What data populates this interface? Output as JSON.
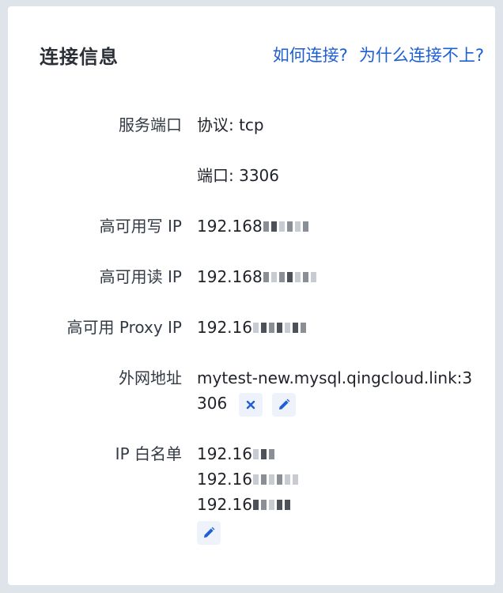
{
  "title": "连接信息",
  "links": {
    "how_to_connect": "如何连接?",
    "why_cant_connect": "为什么连接不上?"
  },
  "service_port": {
    "label": "服务端口",
    "protocol": "协议: tcp",
    "port": "端口: 3306"
  },
  "ha_write_ip": {
    "label": "高可用写 IP",
    "value": "192.168"
  },
  "ha_read_ip": {
    "label": "高可用读 IP",
    "value": "192.168"
  },
  "ha_proxy_ip": {
    "label": "高可用 Proxy IP",
    "value": "192.16"
  },
  "public_network": {
    "label": "外网地址",
    "value": "mytest-new.mysql.qingcloud.link:3306",
    "delete_icon": "close-icon",
    "edit_icon": "pencil-icon"
  },
  "ip_whitelist": {
    "label": "IP 白名单",
    "items": [
      "192.16",
      "192.16",
      "192.16"
    ],
    "edit_icon": "pencil-icon"
  },
  "colors": {
    "accent": "#1e5fd4",
    "icon_bg": "#eef3fb",
    "page_bg": "#dfe3ea",
    "card_bg": "#ffffff"
  }
}
